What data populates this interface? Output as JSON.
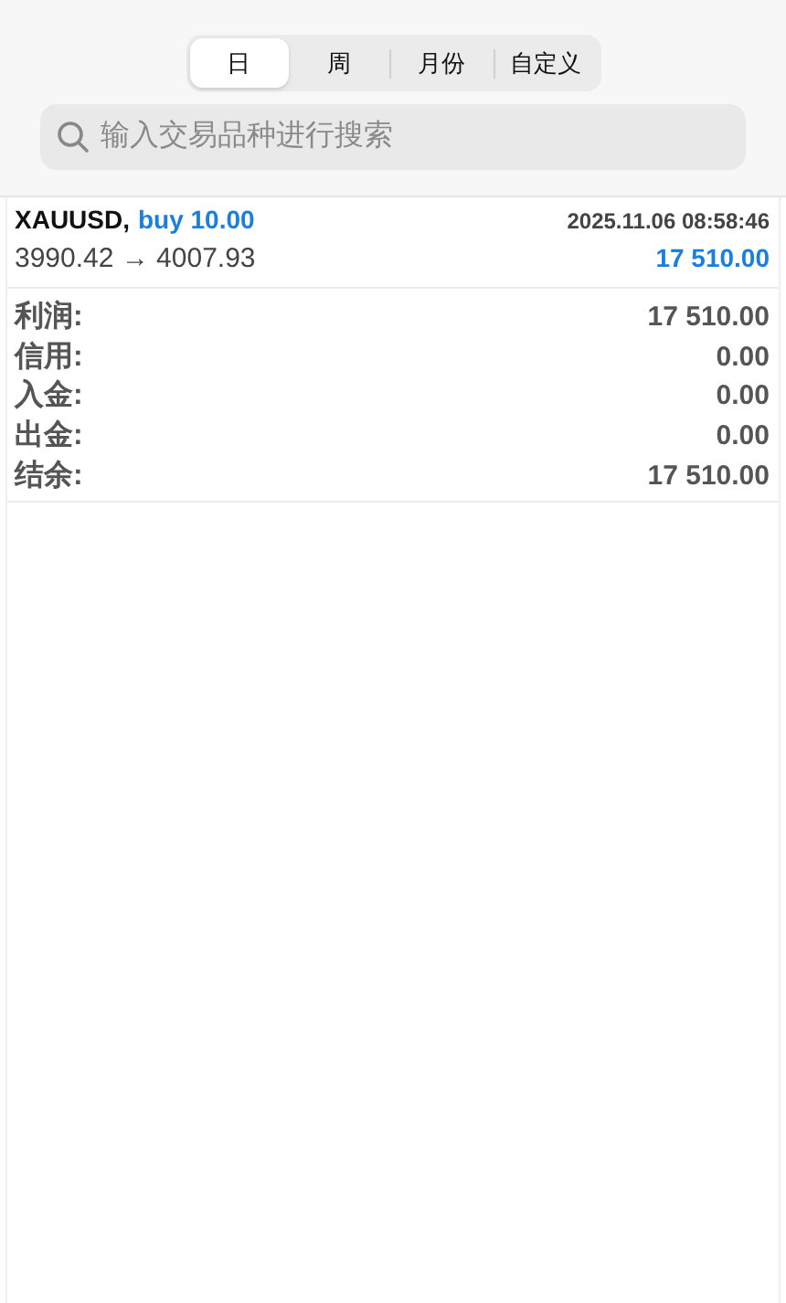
{
  "tabs": [
    {
      "label": "日",
      "selected": true
    },
    {
      "label": "周",
      "selected": false
    },
    {
      "label": "月份",
      "selected": false
    },
    {
      "label": "自定义",
      "selected": false
    }
  ],
  "search": {
    "placeholder": "输入交易品种进行搜索"
  },
  "deals": [
    {
      "symbol": "XAUUSD,",
      "action": "buy 10.00",
      "time": "2025.11.06 08:58:46",
      "prices": "3990.42 → 4007.93",
      "profit": "17 510.00"
    }
  ],
  "summary": [
    {
      "label": "利润:",
      "value": "17 510.00"
    },
    {
      "label": "信用:",
      "value": "0.00"
    },
    {
      "label": "入金:",
      "value": "0.00"
    },
    {
      "label": "出金:",
      "value": "0.00"
    },
    {
      "label": "结余:",
      "value": "17 510.00"
    }
  ]
}
